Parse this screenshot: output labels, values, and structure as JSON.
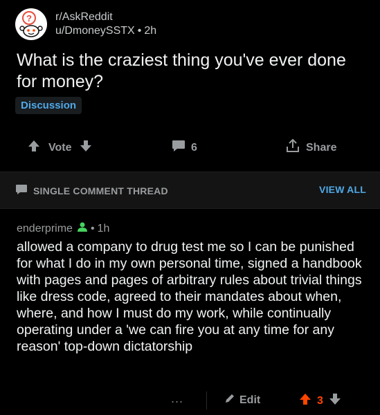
{
  "post": {
    "subreddit": "r/AskReddit",
    "author": "u/DmoneySSTX",
    "separator": "•",
    "age": "2h",
    "title": "What is the craziest thing you've ever done for money?",
    "flair": "Discussion",
    "vote_label": "Vote",
    "comment_count": "6",
    "share_label": "Share"
  },
  "thread": {
    "label": "SINGLE COMMENT THREAD",
    "view_all": "VIEW ALL"
  },
  "comment": {
    "author": "enderprime",
    "separator": "•",
    "age": "1h",
    "body": "allowed a company to drug test me so I can be punished for what I do in my own personal time, signed a handbook with pages and pages of arbitrary rules about trivial things like dress code, agreed to their mandates about when, where, and how I must do my work, while continually operating under a 'we can fire you at any time for any reason' top-down dictatorship",
    "more_label": "...",
    "edit_label": "Edit",
    "score": "3"
  },
  "colors": {
    "background": "#000000",
    "text": "#f0f2f3",
    "muted": "#9a9d9f",
    "link_blue": "#4fa9e8",
    "upvote_orange": "#ff4500",
    "op_icon_green": "#46d160"
  },
  "icons": {
    "avatar": "snoo-question-icon",
    "upvote": "arrow-up-icon",
    "downvote": "arrow-down-icon",
    "comment": "comment-bubble-icon",
    "share": "share-icon",
    "thread": "comment-bubble-icon",
    "op": "person-icon",
    "edit": "pencil-icon"
  }
}
